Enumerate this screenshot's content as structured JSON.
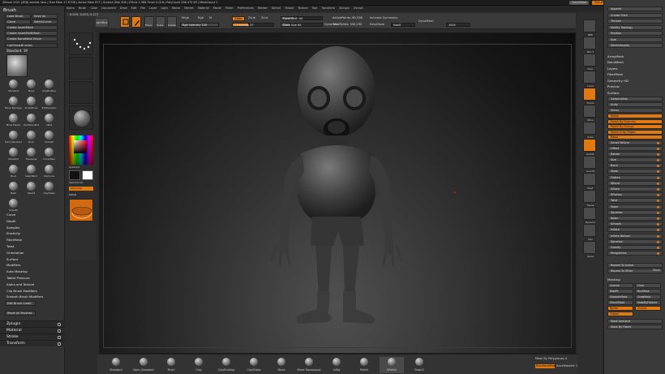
{
  "title_bar": {
    "left_text": "ZBrush 2021 [4R8]  zombie hero | Free Mem 17.97GB | Active Mem 877 | Scratch Disk 206 | ZTime 1.586 Timer 0.016 | PolyCount 336.375 KP | MeshCount 1",
    "quicksave": "QuickSave",
    "see_through": "See-through 0",
    "menus": "Menus",
    "default_zscript": "DefaultZScript"
  },
  "menus": [
    "Alpha",
    "Brush",
    "Color",
    "Document",
    "Draw",
    "Edit",
    "File",
    "Layer",
    "Light",
    "Macro",
    "Marker",
    "Material",
    "Movie",
    "Picker",
    "Preferences",
    "Render",
    "Stencil",
    "Stroke",
    "Texture",
    "Tool",
    "Transform",
    "Zplugin",
    "Zscript"
  ],
  "left_panel": {
    "title": "Brush",
    "buttons": [
      "Load Brush",
      "Save As",
      "Clone",
      "SelectCurve",
      "Create InsertMesh",
      "Create InsertMultiMesh",
      "Create NanoMesh Brush",
      "Lightbox▸Brushes"
    ],
    "current_label": "Standard: 39",
    "brushes": [
      {
        "label": "Standard"
      },
      {
        "label": "Move"
      },
      {
        "label": "ClayBuildup"
      },
      {
        "label": "Move Topological"
      },
      {
        "label": "SnakeHook"
      },
      {
        "label": "TrimDynamic"
      },
      {
        "label": "Move Elastic"
      },
      {
        "label": "DamStandard"
      },
      {
        "label": "Inflat"
      },
      {
        "label": "Dam_Standard"
      },
      {
        "label": "Pinch"
      },
      {
        "label": "Smooth"
      },
      {
        "label": "Standard"
      },
      {
        "label": "Transpose"
      },
      {
        "label": "CurveTube"
      },
      {
        "label": "Move"
      },
      {
        "label": "SelectRect"
      },
      {
        "label": "ClipCurve"
      },
      {
        "label": "Mask"
      },
      {
        "label": "Slash3"
      },
      {
        "label": "ClayTubes"
      },
      {
        "label": "Smooth"
      }
    ],
    "sections": [
      "Curve",
      "Depth",
      "Samples",
      "Elasticity",
      "FiberMesh",
      "Twist",
      "Orientation",
      "Surface",
      "Modifiers",
      "Auto Masking",
      "Tablet Pressure",
      "Alpha and Texture",
      "Clip Brush Modifiers",
      "Smooth Brush Modifiers"
    ],
    "edit_brush_credit": "Edit Brush Credit",
    "reset_all": "Reset All Brushes",
    "bottom_sections": [
      "Zplugin",
      "Material",
      "Stroke",
      "Transform"
    ]
  },
  "shelf": {
    "projection_master": "Projection Master",
    "lightbox": "LightBox",
    "gradient": "Gradient",
    "switch_color": "SwitchColor",
    "alternate": "Alternate",
    "mrgb": "MRGB",
    "material_label": "Matcap Gray"
  },
  "toolbar": {
    "edit": "Edit",
    "draw": "Draw",
    "move": "Move",
    "scale": "Scale",
    "rotate": "Rotate",
    "mrgb": "Mrgb",
    "rgb": "Rgb",
    "m": "M",
    "zadd": "Zadd",
    "zsub": "Zsub",
    "zcut": "Zcut",
    "rgb_intensity": "Rgb Intensity 100",
    "z_intensity": "Z Intensity 37",
    "focal_shift": "Focal Shift -44",
    "draw_size": "Draw Size 64",
    "dynamic": "Dynamic",
    "active_points": "ActivePoints: 85,536",
    "total_points": "TotalPoints: 335,232",
    "activate_symmetry": "Activate Symmetry",
    "easy_view": "EasyMove",
    "dynamesh": "DynaMesh",
    "subdiv": "SubD",
    "resolution": "1024",
    "coords": "0.019, 0.003, 0.117"
  },
  "right_shelf": {
    "items": [
      "BPR",
      "SPix 3",
      "Floor",
      "Local",
      "Frame",
      "Move",
      "Scale",
      "Rotate",
      "Line Fill",
      "PolyF",
      "Transp",
      "Dynamic",
      "Solo",
      "Xpose"
    ]
  },
  "right_panel": {
    "top_items": [
      "Append",
      "Create Shell",
      "Thicken",
      "Modify Topology",
      "Position",
      "Size",
      "MeshIntegrity"
    ],
    "subtools": [
      "ArrayMesh",
      "NanoMesh",
      "Layers",
      "FiberMesh",
      "Geometry HD",
      "Preview",
      "Surface"
    ],
    "deformation": "Deformation",
    "unify": "Unify",
    "mirror": "Mirror",
    "polish_items": [
      "Polish",
      "Polish By Features",
      "Polish By Groups",
      "Polish Crisp Edges",
      "Relax",
      "Smart ReSym"
    ],
    "sliders": [
      "Offset",
      "Rotate",
      "Size",
      "Bend",
      "Skew",
      "Flatten",
      "SBend",
      "SSkew",
      "RFlatten",
      "Twist",
      "Taper",
      "Squeeze",
      "Noise",
      "Smooth",
      "Inflate",
      "Inflate Balloon",
      "Spherize",
      "Gravity",
      "Perspective"
    ],
    "repeat_active": "Repeat To Active",
    "repeat_other": "Repeat To Other",
    "mask": "Mask",
    "masking": "Masking",
    "visibility": "Visibility",
    "polygroups_items": [
      "Inverse",
      "Clear",
      "HidePt",
      "BlurMask",
      "SharpenMask",
      "GrowMask",
      "ShrinkMask",
      "MaskByFeature",
      "Border",
      "Groups",
      "Crease"
    ],
    "mask_ambient": "Mask Ambient",
    "mask_by_fibers": "Mask By Fibers",
    "mask_by_polypaint": "Mask By Polypaint"
  },
  "bottom_brushes": [
    "Standard",
    "Dam_Standard",
    "Pinch",
    "Clay",
    "ClayBuildup",
    "ClayTubes",
    "Move",
    "Move Topological",
    "Inflat",
    "Polish",
    "hPolish",
    "Slash3"
  ],
  "bottom_right": {
    "mask_by_polygroups": "Mask By Polygroups 0",
    "backface": "BackfaceMask",
    "backfacemask_int": "BackMaskInt 1"
  }
}
